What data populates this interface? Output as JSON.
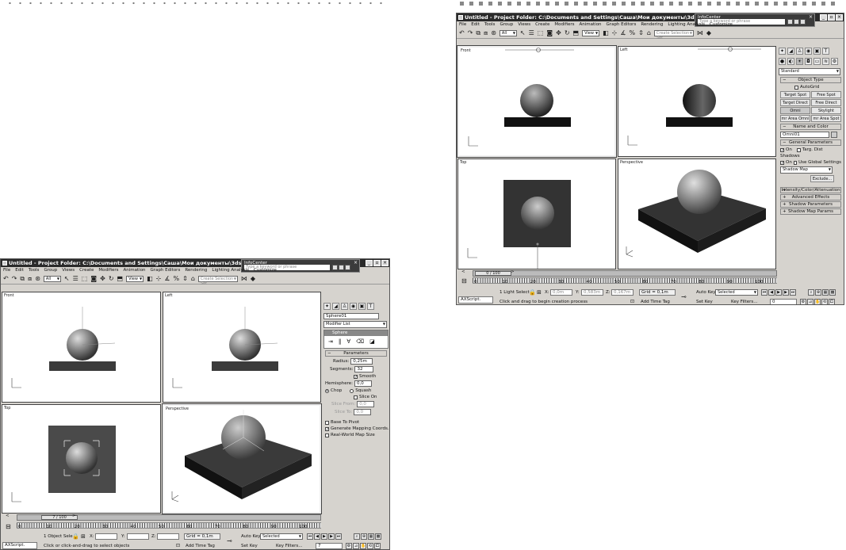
{
  "left": {
    "title": "Untitled    - Project Folder: C:\\Documents and Settings\\Саша\\Мои документы\\3dsmax    - Autodesk",
    "infocenter": {
      "label": "InfoCenter",
      "placeholder": "Type a keyword or phrase"
    },
    "menu": [
      "File",
      "Edit",
      "Tools",
      "Group",
      "Views",
      "Create",
      "Modifiers",
      "Animation",
      "Graph Editors",
      "Rendering",
      "Lighting Analysis",
      "Customize"
    ],
    "filter_value": "All",
    "refcoord_value": "View",
    "selection_set_placeholder": "Create Selection Set",
    "viewports": [
      "Front",
      "Left",
      "Top",
      "Perspective"
    ],
    "object_name": "Sphere01",
    "modifier_list": "Modifier List",
    "stack_item": "Sphere",
    "rollout_title": "Parameters",
    "radius_label": "Radius:",
    "radius_value": "0,25m",
    "segments_label": "Segments:",
    "segments_value": "32",
    "smooth_label": "Smooth",
    "hemisphere_label": "Hemisphere:",
    "hemisphere_value": "0,0",
    "chop_label": "Chop",
    "squash_label": "Squash",
    "slice_on_label": "Slice On",
    "slice_from_label": "Slice From:",
    "slice_from_value": "0,0",
    "slice_to_label": "Slice To:",
    "slice_to_value": "0,0",
    "base_pivot_label": "Base To Pivot",
    "gen_map_label": "Generate Mapping Coords.",
    "realworld_label": "Real-World Map Size",
    "time_slider": "7 / 100",
    "ticks": [
      "0",
      "10",
      "20",
      "30",
      "40",
      "50",
      "60",
      "70",
      "80",
      "90",
      "100"
    ],
    "maxscript": "AXScript.",
    "status_sel": "1 Object Sele",
    "prompt": "Click or click-and-drag to select objects",
    "x_label": "X:",
    "y_label": "Y:",
    "z_label": "Z:",
    "grid": "Grid = 0,1m",
    "add_time_tag": "Add Time Tag",
    "auto_key": "Auto Key",
    "set_key": "Set Key",
    "selected": "Selected",
    "key_filters": "Key Filters...",
    "frame": "7"
  },
  "right": {
    "title": "Untitled    - Project Folder: C:\\Documents and Settings\\Саша\\Мои документы\\3dsmax    - Auto",
    "infocenter": {
      "label": "InfoCenter",
      "placeholder": "Type a keyword or phrase"
    },
    "menu": [
      "File",
      "Edit",
      "Tools",
      "Group",
      "Views",
      "Create",
      "Modifiers",
      "Animation",
      "Graph Editors",
      "Rendering",
      "Lighting Analysis",
      "Customize"
    ],
    "filter_value": "All",
    "refcoord_value": "View",
    "selection_set_placeholder": "Create Selection Set",
    "viewports": [
      "Front",
      "Left",
      "Top",
      "Perspective"
    ],
    "category_value": "Standard",
    "object_type_title": "Object Type",
    "autogrid_label": "AutoGrid",
    "light_buttons": [
      "Target Spot",
      "Free Spot",
      "Target Direct",
      "Free Direct",
      "Omni",
      "Skylight",
      "mr Area Omni",
      "mr Area Spot"
    ],
    "name_color_title": "Name and Color",
    "object_name": "Omni01",
    "general_title": "General Parameters",
    "on_label": "On",
    "targ_dist_label": "Targ. Dist",
    "shadows_label": "Shadows",
    "shadows_on_label": "On",
    "global_settings_label": "Use Global Settings",
    "shadow_type": "Shadow Map",
    "exclude_label": "Exclude...",
    "collapsed_rollouts": [
      "Intensity/Color/Attenuation",
      "Advanced Effects",
      "Shadow Parameters",
      "Shadow Map Params"
    ],
    "time_slider": "0 / 100",
    "ticks": [
      "0",
      "10",
      "20",
      "30",
      "40",
      "50",
      "60",
      "70",
      "80",
      "90",
      "100"
    ],
    "maxscript": "AXScript.",
    "status_sel": "1 Light Select",
    "prompt": "Click and drag to begin creation process",
    "x_label": "X:",
    "x_value": "0,0m",
    "y_label": "Y:",
    "y_value": "0,583m",
    "z_label": "Z:",
    "z_value": "0,167m",
    "grid": "Grid = 0,1m",
    "add_time_tag": "Add Time Tag",
    "auto_key": "Auto Key",
    "set_key": "Set Key",
    "selected": "Selected",
    "key_filters": "Key Filters...",
    "frame": "0"
  }
}
